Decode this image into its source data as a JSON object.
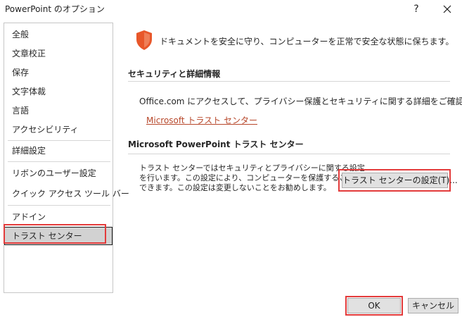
{
  "window": {
    "title": "PowerPoint のオプション",
    "help_label": "?",
    "close_icon": "close-icon"
  },
  "sidebar": {
    "items": [
      {
        "label": "全般"
      },
      {
        "label": "文章校正"
      },
      {
        "label": "保存"
      },
      {
        "label": "文字体裁"
      },
      {
        "label": "言語"
      },
      {
        "label": "アクセシビリティ"
      },
      {
        "label": "詳細設定"
      },
      {
        "label": "リボンのユーザー設定"
      },
      {
        "label": "クイック アクセス ツール バー"
      },
      {
        "label": "アドイン"
      },
      {
        "label": "トラスト センター",
        "selected": true
      }
    ]
  },
  "main": {
    "intro": "ドキュメントを安全に守り、コンピューターを正常で安全な状態に保ちます。",
    "security_section": {
      "heading": "セキュリティと詳細情報",
      "text": "Office.com にアクセスして、プライバシー保護とセキュリティに関する詳細をご確認ください。",
      "link": "Microsoft トラスト センター"
    },
    "trust_section": {
      "heading": "Microsoft PowerPoint トラスト センター",
      "lines": [
        "トラスト センターではセキュリティとプライバシーに関する設定",
        "を行います。この設定により、コンピューターを保護することが",
        "できます。この設定は変更しないことをお勧めします。"
      ],
      "button": "トラスト センターの設定(T)..."
    }
  },
  "footer": {
    "ok": "OK",
    "cancel": "キャンセル"
  },
  "colors": {
    "accent_red": "#e33b3b",
    "link": "#b7472a",
    "shield": "#e8572a"
  }
}
